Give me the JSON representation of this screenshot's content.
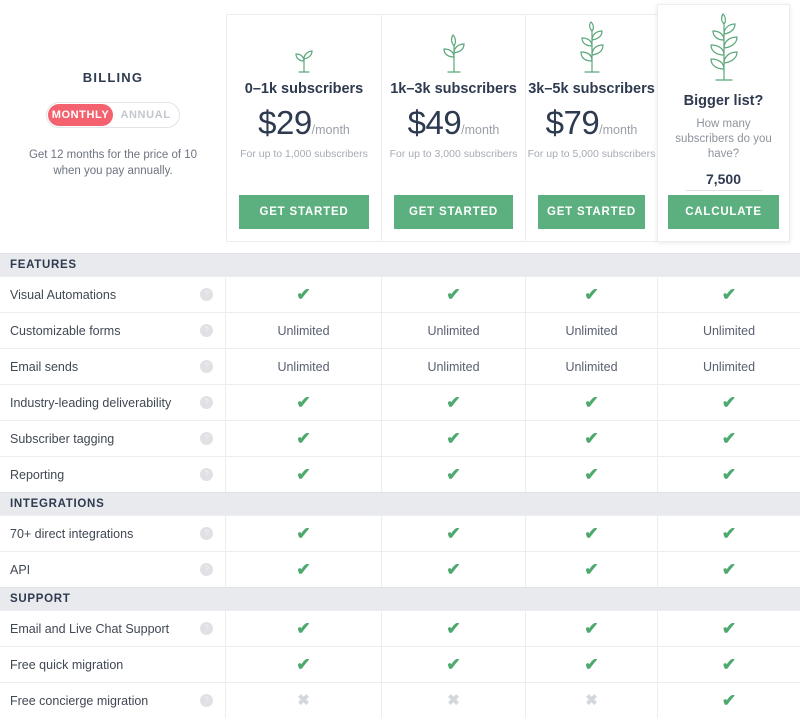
{
  "billing": {
    "title": "BILLING",
    "toggle": {
      "monthly": "MONTHLY",
      "annual": "ANNUAL",
      "selected": "MONTHLY"
    },
    "note": "Get 12 months for the price of 10 when you pay annually.",
    "accent_color": "#f4626f"
  },
  "plans": [
    {
      "icon": "seedling-small-icon",
      "name": "0–1k subscribers",
      "amount": "$29",
      "period": "/month",
      "sub": "For up to 1,000 subscribers",
      "cta": "GET STARTED"
    },
    {
      "icon": "seedling-medium-icon",
      "name": "1k–3k subscribers",
      "amount": "$49",
      "period": "/month",
      "sub": "For up to 3,000 subscribers",
      "cta": "GET STARTED"
    },
    {
      "icon": "plant-large-icon",
      "name": "3k–5k subscribers",
      "amount": "$79",
      "period": "/month",
      "sub": "For up to 5,000 subscribers",
      "cta": "GET STARTED"
    }
  ],
  "calculator": {
    "icon": "plant-tall-icon",
    "title": "Bigger list?",
    "question": "How many subscribers do you have?",
    "value": "7,500",
    "placeholder": "7,500",
    "cta": "CALCULATE"
  },
  "button_color": "#5cb07f",
  "check_color": "#4ea96f",
  "cross_color": "#d4d7db",
  "sections": [
    {
      "heading": "FEATURES",
      "rows": [
        {
          "label": "Visual Automations",
          "info": true,
          "values": [
            "check",
            "check",
            "check",
            "check"
          ]
        },
        {
          "label": "Customizable forms",
          "info": true,
          "values": [
            "Unlimited",
            "Unlimited",
            "Unlimited",
            "Unlimited"
          ]
        },
        {
          "label": "Email sends",
          "info": true,
          "values": [
            "Unlimited",
            "Unlimited",
            "Unlimited",
            "Unlimited"
          ]
        },
        {
          "label": "Industry-leading deliverability",
          "info": true,
          "values": [
            "check",
            "check",
            "check",
            "check"
          ]
        },
        {
          "label": "Subscriber tagging",
          "info": true,
          "values": [
            "check",
            "check",
            "check",
            "check"
          ]
        },
        {
          "label": "Reporting",
          "info": true,
          "values": [
            "check",
            "check",
            "check",
            "check"
          ]
        }
      ]
    },
    {
      "heading": "INTEGRATIONS",
      "rows": [
        {
          "label": "70+ direct integrations",
          "info": true,
          "values": [
            "check",
            "check",
            "check",
            "check"
          ]
        },
        {
          "label": "API",
          "info": true,
          "values": [
            "check",
            "check",
            "check",
            "check"
          ]
        }
      ]
    },
    {
      "heading": "SUPPORT",
      "rows": [
        {
          "label": "Email and Live Chat Support",
          "info": true,
          "values": [
            "check",
            "check",
            "check",
            "check"
          ]
        },
        {
          "label": "Free quick migration",
          "info": false,
          "values": [
            "check",
            "check",
            "check",
            "check"
          ]
        },
        {
          "label": "Free concierge migration",
          "info": true,
          "values": [
            "cross",
            "cross",
            "cross",
            "check"
          ]
        }
      ]
    }
  ]
}
